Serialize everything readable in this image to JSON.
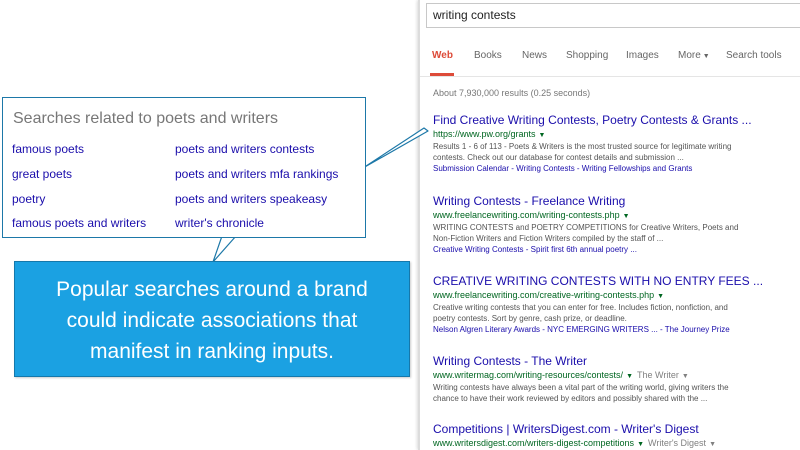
{
  "serp": {
    "query": "writing contests",
    "tabs": [
      "Web",
      "Books",
      "News",
      "Shopping",
      "Images",
      "More",
      "Search tools"
    ],
    "stats": "About 7,930,000 results (0.25 seconds)",
    "results": [
      {
        "title": "Find Creative Writing Contests, Poetry Contests & Grants ...",
        "url": "https://www.pw.org/grants",
        "snippet_lines": [
          "Results 1 - 6 of 113 - Poets & Writers is the most trusted source for legitimate writing",
          "contests. Check out our database for contest details and submission ..."
        ],
        "links": "Submission Calendar - Writing Contests - Writing Fellowships and Grants"
      },
      {
        "title": "Writing Contests - Freelance Writing",
        "url": "www.freelancewriting.com/writing-contests.php",
        "snippet_lines": [
          "WRITING CONTESTS and POETRY COMPETITIONS for Creative Writers, Poets and",
          "Non-Fiction Writers and Fiction Writers compiled by the staff of ..."
        ],
        "links": "Creative Writing Contests - Spirit first 6th annual poetry ..."
      },
      {
        "title": "CREATIVE WRITING CONTESTS WITH NO ENTRY FEES ...",
        "url": "www.freelancewriting.com/creative-writing-contests.php",
        "snippet_lines": [
          "Creative writing contests that you can enter for free. Includes fiction, nonfiction, and",
          "poetry contests. Sort by genre, cash prize, or deadline."
        ],
        "links": "Nelson Algren Literary Awards - NYC EMERGING WRITERS ... - The Journey Prize"
      },
      {
        "title": "Writing Contests - The Writer",
        "url": "www.writermag.com/writing-resources/contests/",
        "source": "The Writer",
        "snippet_lines": [
          "Writing contests have always been a vital part of the writing world, giving writers the",
          "chance to have their work reviewed by editors and possibly shared with the ..."
        ]
      },
      {
        "title": "Competitions | WritersDigest.com - Writer's Digest",
        "url": "www.writersdigest.com/writers-digest-competitions",
        "source": "Writer's Digest"
      }
    ]
  },
  "related": {
    "title": "Searches related to poets and writers",
    "items": [
      "famous poets",
      "great poets",
      "poetry",
      "famous poets and writers",
      "poets and writers contests",
      "poets and writers mfa rankings",
      "poets and writers speakeasy",
      "writer's chronicle"
    ]
  },
  "callout": {
    "lines": [
      "Popular searches around a brand",
      "could indicate associations that",
      "manifest in ranking inputs."
    ]
  },
  "colors": {
    "callout_bg": "#1ba1e2",
    "callout_border": "#1578ab",
    "link": "#1a0dab",
    "url_green": "#006621",
    "active_tab": "#dd4b39"
  }
}
